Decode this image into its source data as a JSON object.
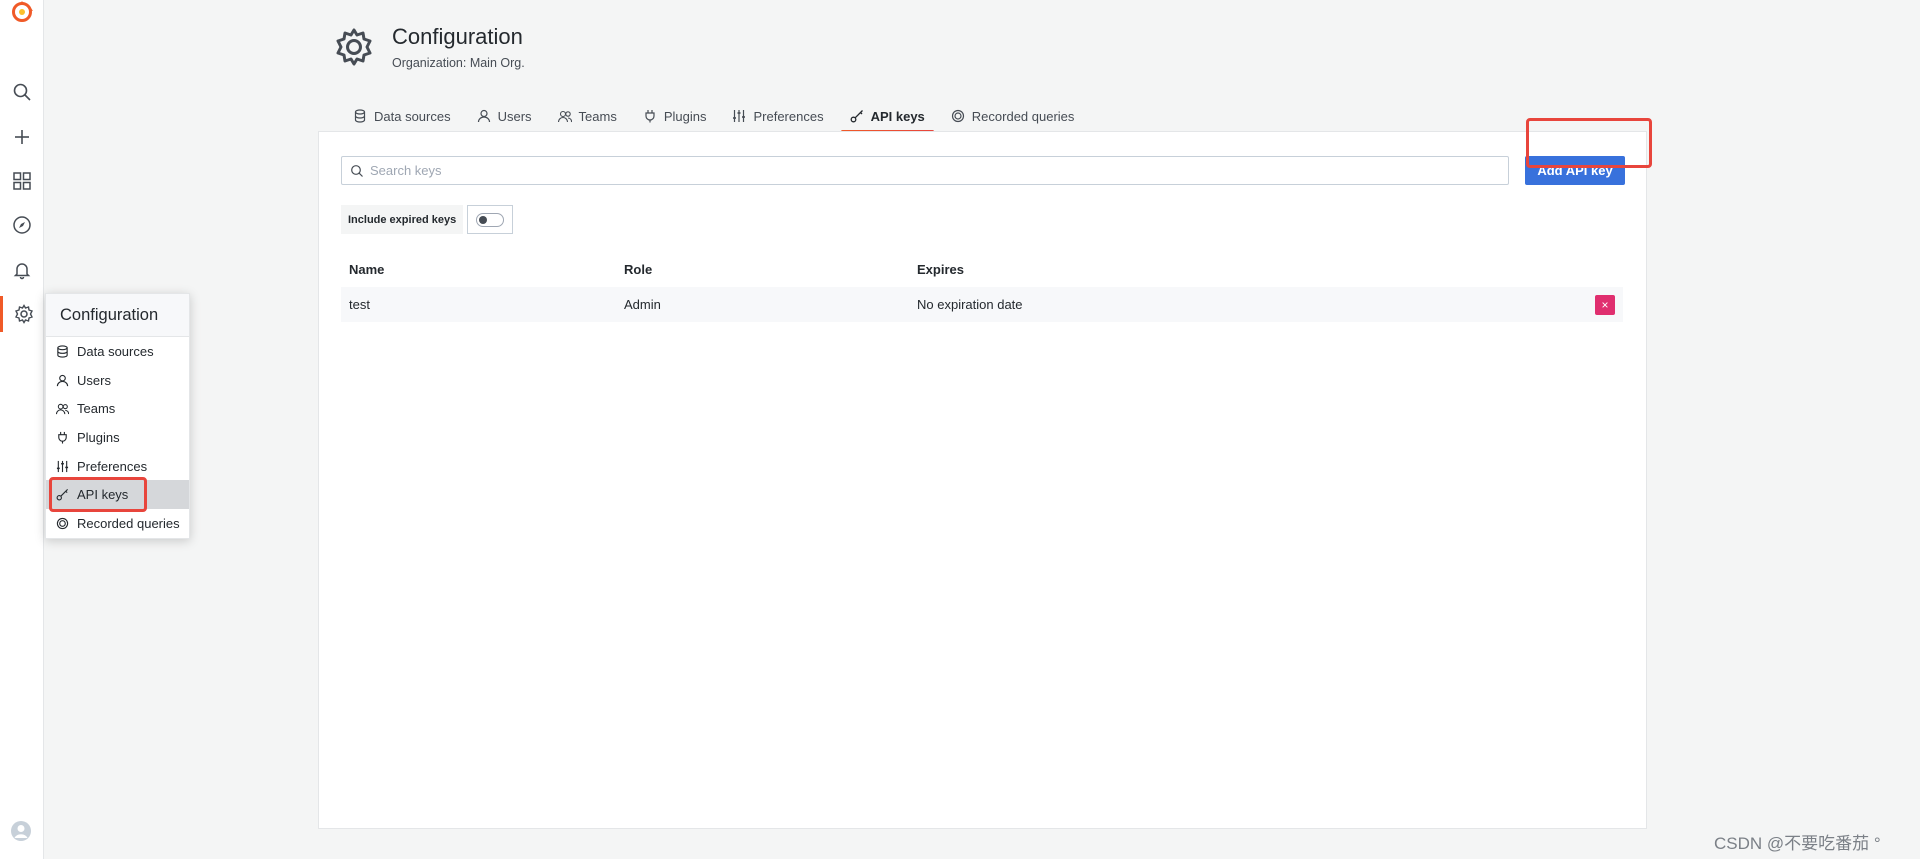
{
  "sidenav": {
    "icons": [
      "grafana-logo",
      "search-icon",
      "plus-icon",
      "dashboards-icon",
      "compass-icon",
      "bell-icon",
      "gear-icon",
      "user-avatar-icon"
    ]
  },
  "flyout": {
    "title": "Configuration",
    "items": [
      {
        "label": "Data sources",
        "icon": "database-icon"
      },
      {
        "label": "Users",
        "icon": "user-icon"
      },
      {
        "label": "Teams",
        "icon": "users-icon"
      },
      {
        "label": "Plugins",
        "icon": "plug-icon"
      },
      {
        "label": "Preferences",
        "icon": "sliders-icon"
      },
      {
        "label": "API keys",
        "icon": "key-icon",
        "active": true
      },
      {
        "label": "Recorded queries",
        "icon": "record-icon"
      }
    ]
  },
  "header": {
    "title": "Configuration",
    "subtitle": "Organization: Main Org."
  },
  "tabs": [
    {
      "label": "Data sources",
      "icon": "database-icon"
    },
    {
      "label": "Users",
      "icon": "user-icon"
    },
    {
      "label": "Teams",
      "icon": "users-icon"
    },
    {
      "label": "Plugins",
      "icon": "plug-icon"
    },
    {
      "label": "Preferences",
      "icon": "sliders-icon"
    },
    {
      "label": "API keys",
      "icon": "key-icon",
      "active": true
    },
    {
      "label": "Recorded queries",
      "icon": "record-icon"
    }
  ],
  "search": {
    "placeholder": "Search keys",
    "value": ""
  },
  "add_button": "Add API key",
  "include_expired": {
    "label": "Include expired keys",
    "checked": false
  },
  "table": {
    "headers": [
      "Name",
      "Role",
      "Expires"
    ],
    "rows": [
      {
        "name": "test",
        "role": "Admin",
        "expires": "No expiration date",
        "delete_label": "×"
      }
    ]
  },
  "watermark": "CSDN @不要吃番茄 °",
  "colors": {
    "accent": "#f05a28",
    "primary_button": "#3871dc",
    "danger": "#e02f6f",
    "highlight": "#e8453c"
  }
}
